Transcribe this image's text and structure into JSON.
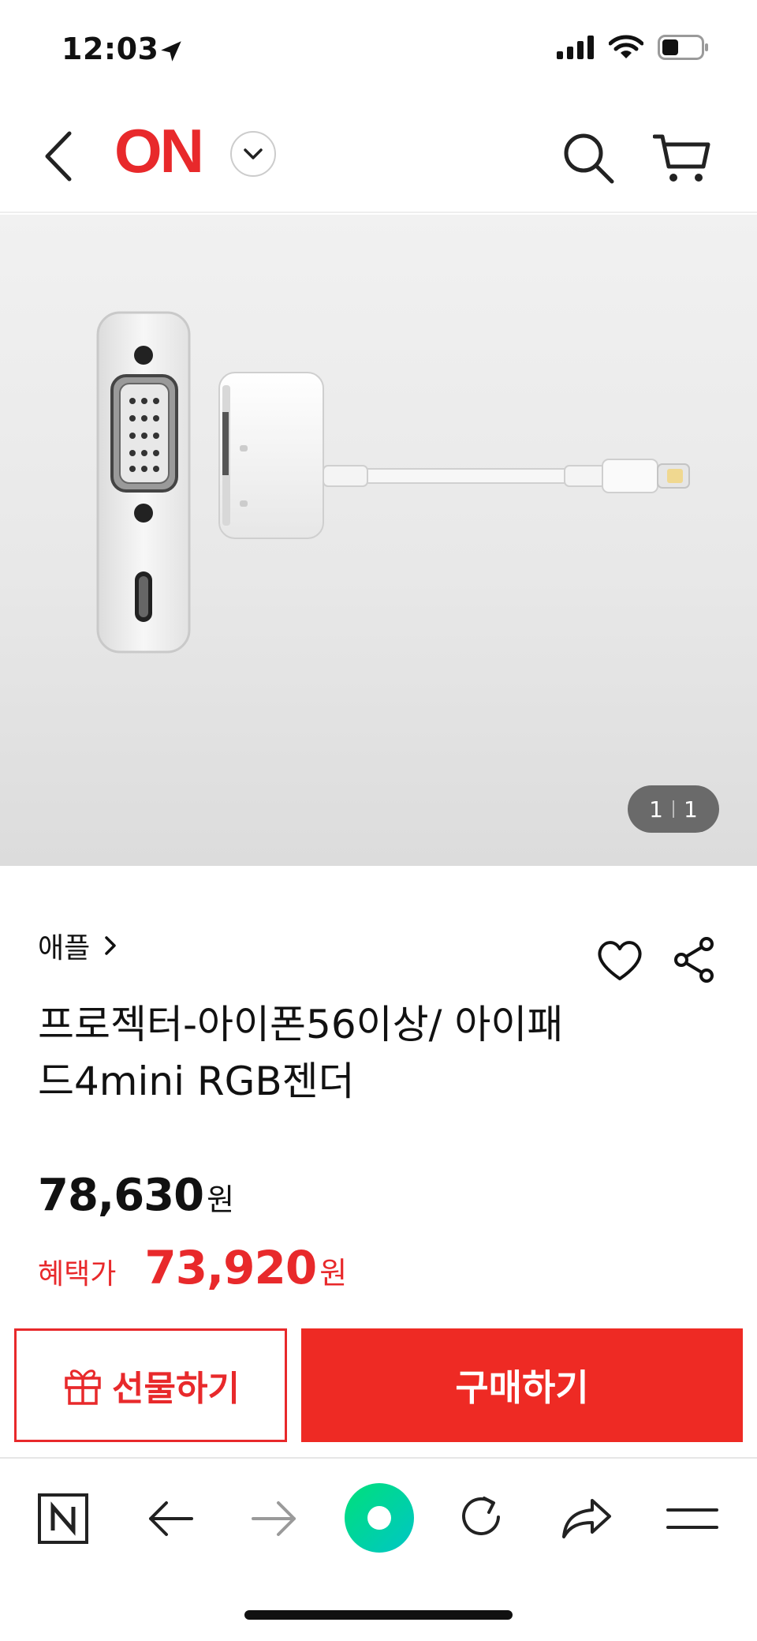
{
  "status_bar": {
    "time": "12:03"
  },
  "header": {
    "logo": "ON",
    "icons": [
      "back-icon",
      "chevron-down-icon",
      "search-icon",
      "cart-icon"
    ]
  },
  "gallery": {
    "current": "1",
    "total": "1"
  },
  "product": {
    "brand": "애플",
    "title": "프로젝터-아이폰56이상/ 아이패드4mini RGB젠더",
    "price": "78,630",
    "price_unit": "원",
    "benefit_label": "혜택가",
    "benefit_price": "73,920",
    "benefit_unit": "원"
  },
  "actions": {
    "gift_label": "선물하기",
    "buy_label": "구매하기"
  },
  "browser_toolbar": {
    "icons": [
      "naver-n-icon",
      "back-arrow-icon",
      "forward-arrow-icon",
      "green-dot-icon",
      "reload-icon",
      "share-arrow-icon",
      "menu-icon"
    ]
  },
  "colors": {
    "brand_red": "#e8292b",
    "buy_red": "#ee2a24",
    "green_dot": "#00d68f"
  }
}
